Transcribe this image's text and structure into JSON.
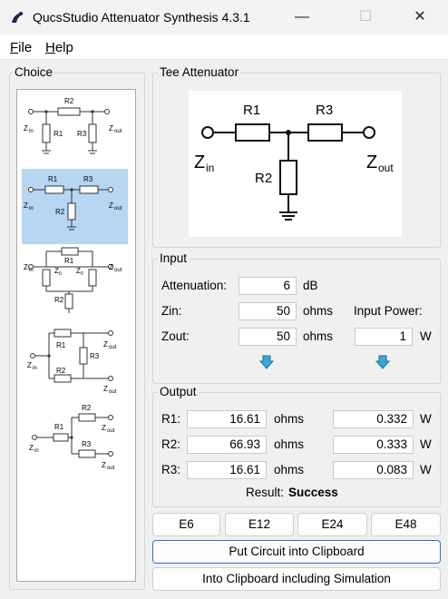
{
  "window": {
    "title": "QucsStudio Attenuator Synthesis 4.3.1",
    "minimize": "—",
    "maximize": "☐",
    "close": "✕"
  },
  "menu": {
    "file": "File",
    "help": "Help"
  },
  "choice": {
    "title": "Choice",
    "selected_index": 1
  },
  "preview": {
    "title": "Tee Attenuator",
    "r1": "R1",
    "r2": "R2",
    "r3": "R3",
    "zin": "Z",
    "zin_sub": "in",
    "zout": "Z",
    "zout_sub": "out"
  },
  "input": {
    "title": "Input",
    "attenuation_label": "Attenuation:",
    "attenuation_value": "6",
    "attenuation_unit": "dB",
    "zin_label": "Zin:",
    "zin_value": "50",
    "zin_unit": "ohms",
    "zout_label": "Zout:",
    "zout_value": "50",
    "zout_unit": "ohms",
    "power_label": "Input Power:",
    "power_value": "1",
    "power_unit": "W"
  },
  "output": {
    "title": "Output",
    "rows": [
      {
        "label": "R1:",
        "value": "16.61",
        "unit": "ohms",
        "power": "0.332",
        "power_unit": "W"
      },
      {
        "label": "R2:",
        "value": "66.93",
        "unit": "ohms",
        "power": "0.333",
        "power_unit": "W"
      },
      {
        "label": "R3:",
        "value": "16.61",
        "unit": "ohms",
        "power": "0.083",
        "power_unit": "W"
      }
    ],
    "result_label": "Result:",
    "result_value": "Success"
  },
  "series_buttons": [
    "E6",
    "E12",
    "E24",
    "E48"
  ],
  "actions": {
    "clipboard": "Put Circuit into Clipboard",
    "clipboard_sim": "Into Clipboard including Simulation"
  },
  "colors": {
    "selection": "#b6d6f2",
    "arrow": "#3aa7d8",
    "focus": "#2c6fd6"
  }
}
